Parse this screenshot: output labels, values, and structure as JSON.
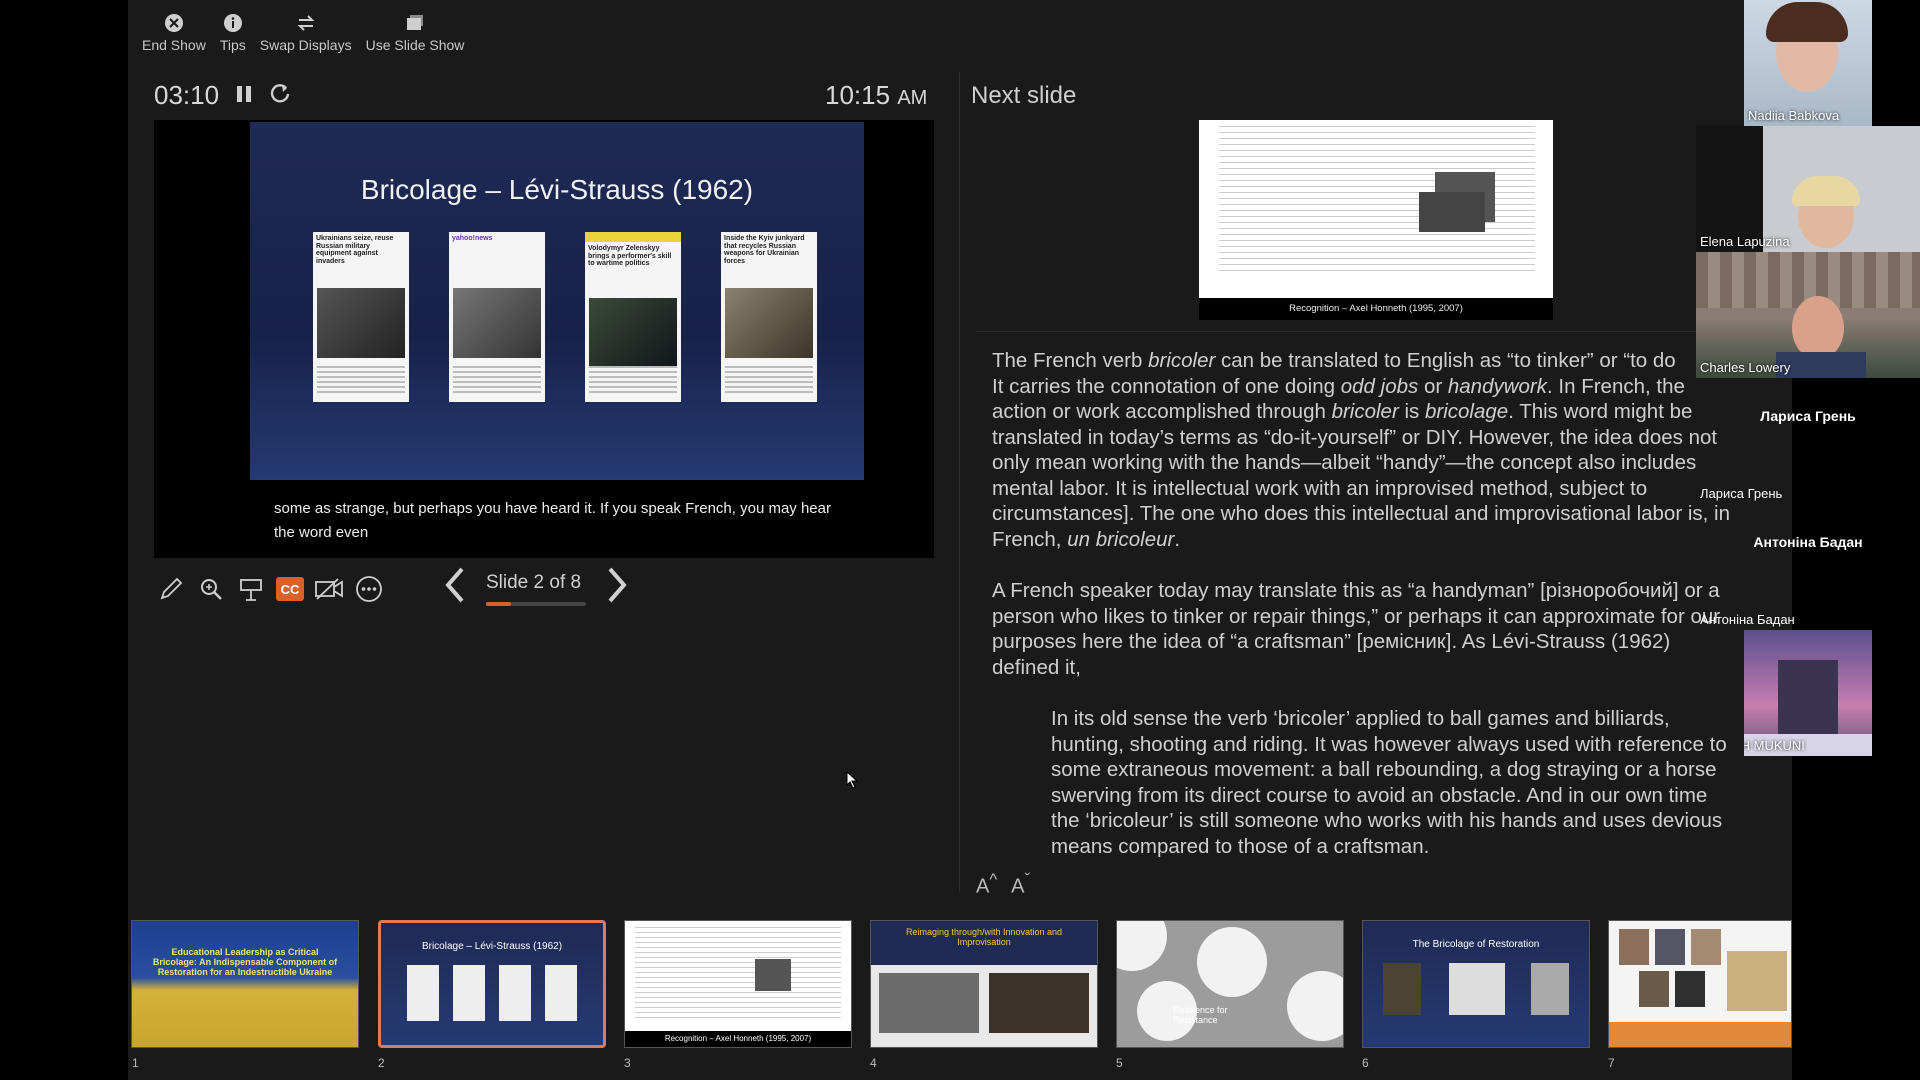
{
  "toolbar": {
    "end_show": "End Show",
    "tips": "Tips",
    "swap_displays": "Swap Displays",
    "use_slide_show": "Use Slide Show"
  },
  "timer": {
    "elapsed": "03:10",
    "clock": "10:15",
    "ampm": "AM"
  },
  "current_slide": {
    "title": "Bricolage – Lévi-Strauss (1962)",
    "articles": [
      "Ukrainians seize, reuse Russian military equipment against invaders",
      "yahoo!news",
      "Volodymyr Zelenskyy brings a performer's skill to wartime politics",
      "Inside the Kyiv junkyard that recycles Russian weapons for Ukrainian forces"
    ],
    "caption": "some as strange, but perhaps you have heard it. If you speak French, you may hear the word even",
    "cc_label": "CC"
  },
  "navigation": {
    "slide_label": "Slide 2 of 8",
    "progress": 0.25
  },
  "next_slide": {
    "label": "Next slide",
    "caption": "Recognition – Axel Honneth (1995, 2007)"
  },
  "notes": {
    "p1": [
      "The French verb <i>bricoler</i> can be translated to English as “to tinker” or “to do",
      "It carries the connotation of one doing <i>odd jobs</i> or <i>handywork</i>. In French, the",
      "action or work accomplished through <i>bricoler</i> is <i>bricolage</i>. This word might be",
      "translated in today’s terms as “do-it-yourself” or DIY. However, the idea does not",
      "only mean working with the hands—albeit “handy”—the concept also includes",
      "mental labor. It is intellectual work with an improvised method, subject to",
      "circumstances]. The one who does this intellectual and improvisational labor is, in",
      "French, <i>un bricoleur</i>."
    ],
    "p2": [
      "A French speaker today may translate this as “a handyman” [різноробочий] or a",
      "person who likes to tinker or repair things,” or perhaps it can approximate for our",
      "purposes here the idea of “a craftsman” [ремісник]. As Lévi-Strauss (1962)",
      "defined it,"
    ],
    "quote": [
      "In its old sense the verb ‘bricoler’ applied to ball games and billiards,",
      "hunting, shooting and riding. It was however always used with reference to",
      "some extraneous movement: a ball rebounding, a dog straying or a horse",
      "swerving from its direct course to avoid an obstacle. And in our own time",
      "the ‘bricoleur’ is still someone who works with his hands and uses devious",
      "means compared to those of a craftsman."
    ],
    "font_increase": "A",
    "font_decrease": "A"
  },
  "participants": [
    {
      "name": "Nadiia Babkova"
    },
    {
      "name": "Elena Lapuzina"
    },
    {
      "name": "Charles Lowery"
    },
    {
      "name": "Лариса Грень"
    },
    {
      "name": "Антоніна Бадан"
    },
    {
      "name": "JOSEPH MUKUNI"
    }
  ],
  "filmstrip": [
    {
      "num": "1",
      "title": "Educational Leadership as Critical Bricolage: An Indispensable Component of Restoration for an Indestructible Ukraine"
    },
    {
      "num": "2",
      "title": "Bricolage – Lévi-Strauss (1962)"
    },
    {
      "num": "3",
      "title": "Recognition – Axel Honneth (1995, 2007)"
    },
    {
      "num": "4",
      "title": "Reimaging through/with Innovation and Improvisation"
    },
    {
      "num": "5",
      "title": "Resilience for Resistance"
    },
    {
      "num": "6",
      "title": "The Bricolage of Restoration"
    },
    {
      "num": "7",
      "title": ""
    }
  ]
}
